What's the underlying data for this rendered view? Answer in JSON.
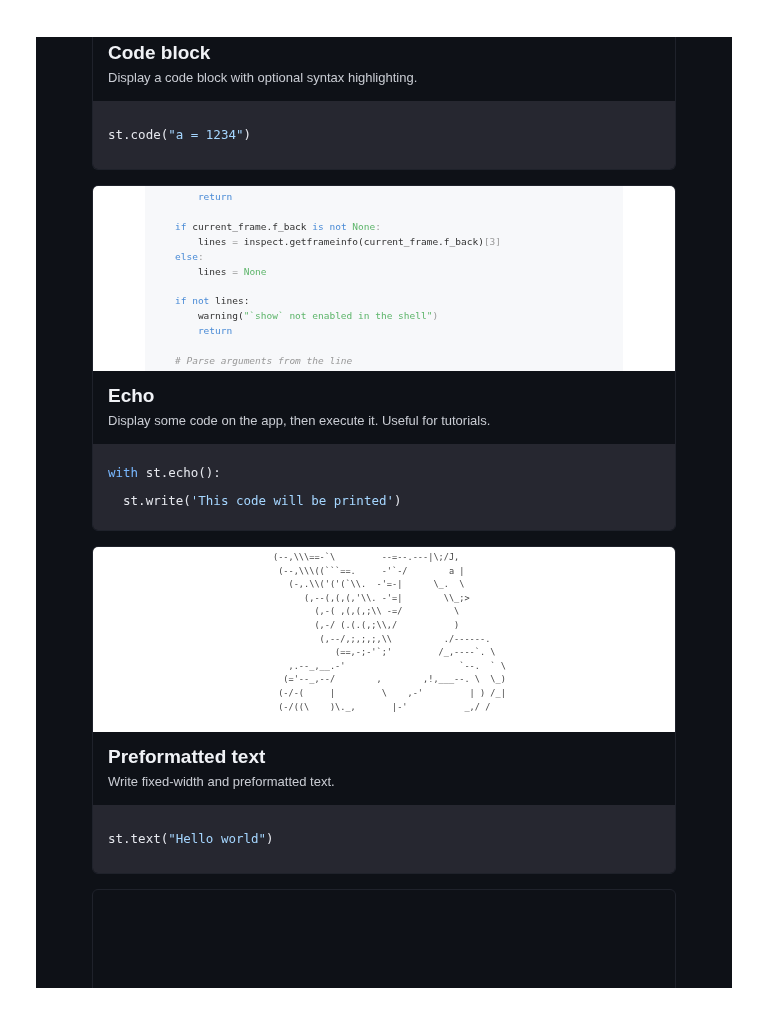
{
  "cards": [
    {
      "kind": "example",
      "title": "Code block",
      "description": "Display a code block with optional syntax highlighting.",
      "code": [
        [
          {
            "text": "st.code(",
            "kind": "plain"
          },
          {
            "text": "\"a = 1234\"",
            "kind": "string"
          },
          {
            "text": ")",
            "kind": "plain"
          }
        ]
      ]
    },
    {
      "kind": "example",
      "preview": {
        "kind": "code",
        "lines": [
          {
            "indented": true,
            "gap_before": false,
            "tokens": [
              {
                "text": "return",
                "kind": "keyword"
              }
            ]
          },
          {
            "indented": false,
            "gap_before": true,
            "tokens": [
              {
                "text": "if",
                "kind": "keyword"
              },
              {
                "text": " current_frame.f_back ",
                "kind": "plain"
              },
              {
                "text": "is not",
                "kind": "keyword"
              },
              {
                "text": " None",
                "kind": "constant"
              },
              {
                "text": ":",
                "kind": "punct"
              }
            ]
          },
          {
            "indented": true,
            "gap_before": false,
            "tokens": [
              {
                "text": "lines ",
                "kind": "plain"
              },
              {
                "text": "=",
                "kind": "punct"
              },
              {
                "text": " inspect.getframeinfo(current_frame.f_back)",
                "kind": "plain"
              },
              {
                "text": "[3]",
                "kind": "punct"
              }
            ]
          },
          {
            "indented": false,
            "gap_before": false,
            "tokens": [
              {
                "text": "else",
                "kind": "keyword"
              },
              {
                "text": ":",
                "kind": "punct"
              }
            ]
          },
          {
            "indented": true,
            "gap_before": false,
            "tokens": [
              {
                "text": "lines ",
                "kind": "plain"
              },
              {
                "text": "=",
                "kind": "punct"
              },
              {
                "text": " None",
                "kind": "constant"
              }
            ]
          },
          {
            "indented": false,
            "gap_before": true,
            "tokens": [
              {
                "text": "if",
                "kind": "keyword"
              },
              {
                "text": " not",
                "kind": "keyword"
              },
              {
                "text": " lines:",
                "kind": "plain"
              }
            ]
          },
          {
            "indented": true,
            "gap_before": false,
            "tokens": [
              {
                "text": "warning(",
                "kind": "plain"
              },
              {
                "text": "\"`show` not enabled in the shell\"",
                "kind": "constant"
              },
              {
                "text": ")",
                "kind": "punct"
              }
            ]
          },
          {
            "indented": true,
            "gap_before": false,
            "tokens": [
              {
                "text": "return",
                "kind": "keyword"
              }
            ]
          },
          {
            "indented": false,
            "gap_before": true,
            "tokens": [
              {
                "text": "# Parse arguments from the line",
                "kind": "comment"
              }
            ]
          }
        ]
      },
      "title": "Echo",
      "description": "Display some code on the app, then execute it. Useful for tutorials.",
      "code": [
        [
          {
            "text": "with",
            "kind": "keyword"
          },
          {
            "text": " st.echo():",
            "kind": "plain"
          }
        ],
        [
          {
            "text": "  st.write(",
            "kind": "plain"
          },
          {
            "text": "'This code will be printed'",
            "kind": "string"
          },
          {
            "text": ")",
            "kind": "plain"
          }
        ]
      ]
    },
    {
      "kind": "example",
      "preview": {
        "kind": "ascii",
        "lines": [
          "(--,\\\\\\==-`\\         --=--.---|\\;/J,",
          " (--,\\\\\\((```==.     -'`-/        a |",
          "   (-,.\\\\('('(`\\\\.  -'=-|      \\_.  \\",
          "      (,--(,(,(,'\\\\. -'=|        \\\\_;>",
          "        (,-( ,(,(,;\\\\ -=/          \\",
          "        (,-/ (.(.(,;\\\\,/           )",
          "         (,--/,;,;,;,\\\\          ./------.",
          "            (==,-;-'`;'         /_,----`. \\",
          "   ,.--_,__.-'                      `--.  ` \\",
          "  (='--_,--/        ,        ,!,___--. \\  \\_)",
          " (-/-(     |         \\    ,-'         | ) /_|",
          " (-/((\\    )\\._,       |-'           _,/ /"
        ]
      },
      "title": "Preformatted text",
      "description": "Write fixed-width and preformatted text.",
      "code": [
        [
          {
            "text": "st.text(",
            "kind": "plain"
          },
          {
            "text": "\"Hello world\"",
            "kind": "string"
          },
          {
            "text": ")",
            "kind": "plain"
          }
        ]
      ]
    },
    {
      "kind": "empty"
    }
  ]
}
